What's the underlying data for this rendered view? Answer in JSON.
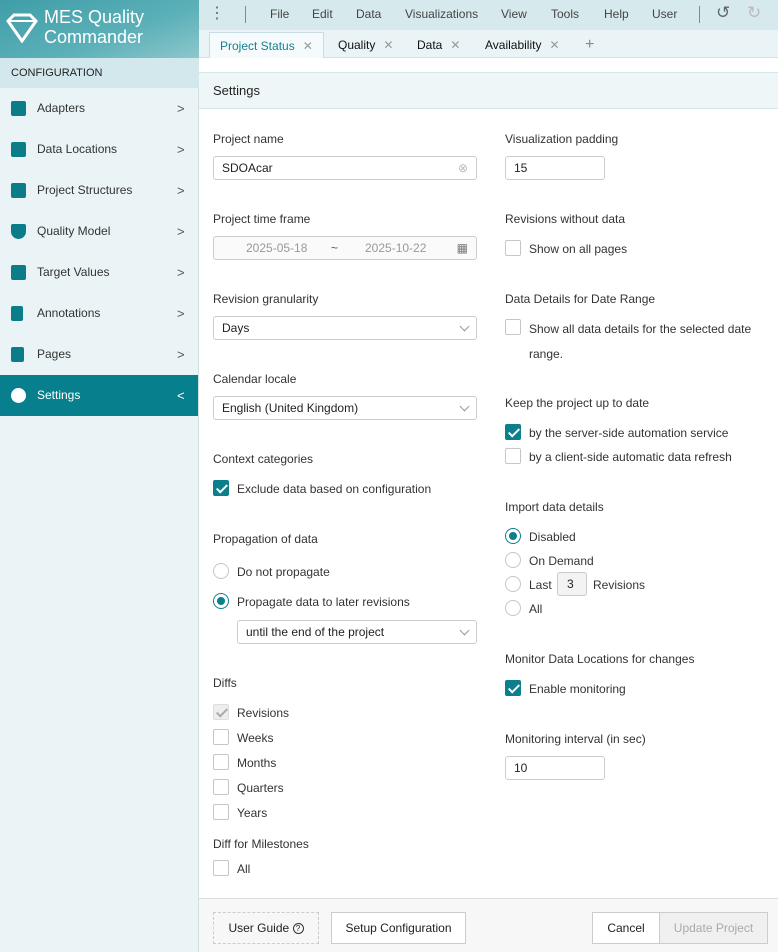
{
  "app": {
    "title_line1": "MES Quality",
    "title_line2": "Commander"
  },
  "menu": [
    "File",
    "Edit",
    "Data",
    "Visualizations",
    "View",
    "Tools",
    "Help",
    "User"
  ],
  "tabs": [
    {
      "label": "Project Status",
      "active": true
    },
    {
      "label": "Quality"
    },
    {
      "label": "Data"
    },
    {
      "label": "Availability"
    }
  ],
  "sidebar": {
    "header": "CONFIGURATION",
    "items": [
      {
        "label": "Adapters",
        "icon": "plug-icon"
      },
      {
        "label": "Data Locations",
        "icon": "server-icon"
      },
      {
        "label": "Project Structures",
        "icon": "layout-icon"
      },
      {
        "label": "Quality Model",
        "icon": "shield-check-icon"
      },
      {
        "label": "Target Values",
        "icon": "chart-line-icon"
      },
      {
        "label": "Annotations",
        "icon": "bookmark-icon"
      },
      {
        "label": "Pages",
        "icon": "pages-icon"
      },
      {
        "label": "Settings",
        "icon": "gear-icon",
        "selected": true
      }
    ]
  },
  "settings": {
    "title": "Settings",
    "project_name": {
      "label": "Project name",
      "value": "SDOAcar"
    },
    "time_frame": {
      "label": "Project time frame",
      "start": "2025-05-18",
      "sep": "~",
      "end": "2025-10-22"
    },
    "granularity": {
      "label": "Revision granularity",
      "value": "Days"
    },
    "locale": {
      "label": "Calendar locale",
      "value": "English (United Kingdom)"
    },
    "context": {
      "label": "Context categories",
      "option": "Exclude data based on configuration",
      "checked": true
    },
    "propagation": {
      "label": "Propagation of data",
      "options": [
        "Do not propagate",
        "Propagate data to later revisions"
      ],
      "selected": 1,
      "until": "until the end of the project"
    },
    "diffs": {
      "label": "Diffs",
      "options": [
        {
          "label": "Revisions",
          "checked": true,
          "disabled": true
        },
        {
          "label": "Weeks"
        },
        {
          "label": "Months"
        },
        {
          "label": "Quarters"
        },
        {
          "label": "Years"
        }
      ]
    },
    "milestones": {
      "label": "Diff for Milestones",
      "option": "All"
    },
    "padding": {
      "label": "Visualization padding",
      "value": "15"
    },
    "revisions_without_data": {
      "label": "Revisions without data",
      "option": "Show on all pages"
    },
    "date_range": {
      "label": "Data Details for Date Range",
      "option_line1": "Show all data details for the selected date",
      "option_line2": "range."
    },
    "up_to_date": {
      "label": "Keep the project up to date",
      "options": [
        {
          "label": "by the server-side automation service",
          "checked": true
        },
        {
          "label": "by a client-side automatic data refresh",
          "checked": false
        }
      ]
    },
    "import": {
      "label": "Import data details",
      "options": [
        "Disabled",
        "On Demand",
        "Last",
        "All"
      ],
      "selected": 0,
      "last_value": "3",
      "revisions": "Revisions"
    },
    "monitor": {
      "label": "Monitor Data Locations for changes",
      "option": "Enable monitoring",
      "checked": true
    },
    "interval": {
      "label": "Monitoring interval (in sec)",
      "value": "10"
    }
  },
  "footer": {
    "user_guide": "User Guide",
    "help_icon": "?",
    "setup": "Setup Configuration",
    "cancel": "Cancel",
    "update": "Update Project"
  },
  "colors": {
    "accent": "#0b7f8c",
    "header": "#d6eaee",
    "sidebar": "#eaf4f6"
  }
}
